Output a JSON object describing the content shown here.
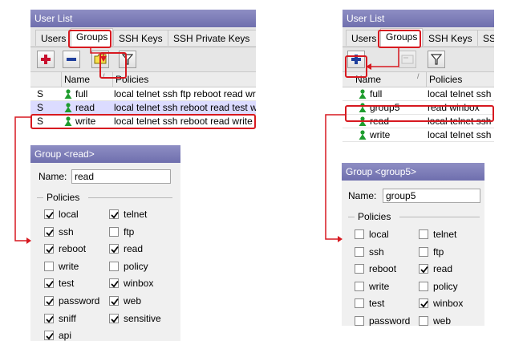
{
  "colors": {
    "title_bar": "#7a7ab8",
    "highlight": "#d71920",
    "selected_row": "#dcdcff"
  },
  "left": {
    "window_title": "User List",
    "tabs": [
      "Users",
      "Groups",
      "SSH Keys",
      "SSH Private Keys"
    ],
    "active_tab": "Groups",
    "toolbar": [
      "add-icon",
      "remove-icon",
      "comment-icon",
      "filter-icon"
    ],
    "columns": {
      "flag": "",
      "name": "Name",
      "policies": "Policies"
    },
    "rows": [
      {
        "flag": "S",
        "name": "full",
        "policies": "local telnet ssh ftp reboot read wr"
      },
      {
        "flag": "S",
        "name": "read",
        "policies": "local telnet ssh reboot read test wi",
        "selected": true
      },
      {
        "flag": "S",
        "name": "write",
        "policies": "local telnet ssh reboot read write t"
      }
    ],
    "dialog": {
      "title": "Group <read>",
      "name_label": "Name:",
      "name_value": "read",
      "section": "Policies",
      "policies": [
        {
          "label": "local",
          "checked": true
        },
        {
          "label": "telnet",
          "checked": true
        },
        {
          "label": "ssh",
          "checked": true
        },
        {
          "label": "ftp",
          "checked": false
        },
        {
          "label": "reboot",
          "checked": true
        },
        {
          "label": "read",
          "checked": true
        },
        {
          "label": "write",
          "checked": false
        },
        {
          "label": "policy",
          "checked": false
        },
        {
          "label": "test",
          "checked": true
        },
        {
          "label": "winbox",
          "checked": true
        },
        {
          "label": "password",
          "checked": true
        },
        {
          "label": "web",
          "checked": true
        },
        {
          "label": "sniff",
          "checked": true
        },
        {
          "label": "sensitive",
          "checked": true
        },
        {
          "label": "api",
          "checked": true
        }
      ]
    }
  },
  "right": {
    "window_title": "User List",
    "tabs": [
      "Users",
      "Groups",
      "SSH Keys",
      "SS"
    ],
    "active_tab": "Groups",
    "toolbar": [
      "add-icon",
      "comment-icon",
      "filter-icon"
    ],
    "columns": {
      "name": "Name",
      "policies": "Policies"
    },
    "rows": [
      {
        "name": "full",
        "policies": "local telnet ssh"
      },
      {
        "name": "group5",
        "policies": "read winbox",
        "selected": true
      },
      {
        "name": "read",
        "policies": "local telnet ssh"
      },
      {
        "name": "write",
        "policies": "local telnet ssh"
      }
    ],
    "dialog": {
      "title": "Group <group5>",
      "name_label": "Name:",
      "name_value": "group5",
      "section": "Policies",
      "policies": [
        {
          "label": "local",
          "checked": false
        },
        {
          "label": "telnet",
          "checked": false
        },
        {
          "label": "ssh",
          "checked": false
        },
        {
          "label": "ftp",
          "checked": false
        },
        {
          "label": "reboot",
          "checked": false
        },
        {
          "label": "read",
          "checked": true
        },
        {
          "label": "write",
          "checked": false
        },
        {
          "label": "policy",
          "checked": false
        },
        {
          "label": "test",
          "checked": false
        },
        {
          "label": "winbox",
          "checked": true
        },
        {
          "label": "password",
          "checked": false
        },
        {
          "label": "web",
          "checked": false
        }
      ]
    }
  }
}
